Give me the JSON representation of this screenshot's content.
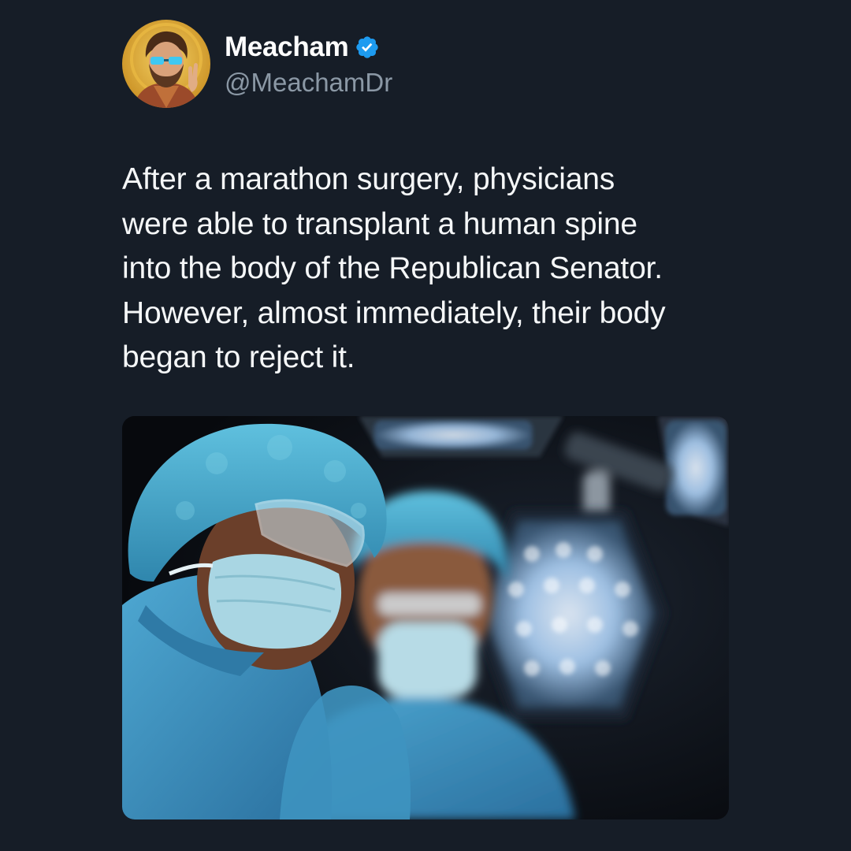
{
  "author": {
    "display_name": "Meacham",
    "handle": "@MeachamDr",
    "verified": true,
    "avatar_icon": "bearded-man-with-glasses-portrait",
    "verified_icon": "verified-badge-icon",
    "verified_color": "#1d9bf0"
  },
  "tweet": {
    "text": "After a marathon surgery, physicians\nwere able to transplant a human spine\ninto the body of the Republican Senator.\nHowever, almost immediately, their body\nbegan to reject it."
  },
  "media": {
    "image_icon": "surgeons-in-operating-room-photo"
  },
  "colors": {
    "background": "#161d27",
    "text": "#f5f7f8",
    "secondary_text": "#8b98a5",
    "scrubs": "#4aa3c8"
  }
}
